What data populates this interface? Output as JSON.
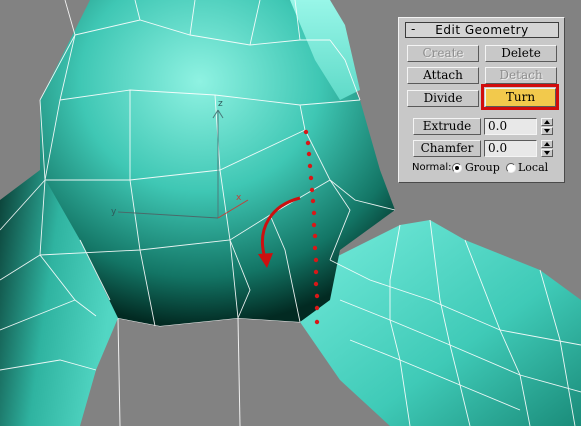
{
  "panel": {
    "collapse_symbol": "-",
    "title": "Edit Geometry",
    "buttons": {
      "create": "Create",
      "delete": "Delete",
      "attach": "Attach",
      "detach": "Detach",
      "divide": "Divide",
      "turn": "Turn",
      "extrude": "Extrude",
      "chamfer": "Chamfer"
    },
    "extrude_value": "0.0",
    "chamfer_value": "0.0",
    "normal_label": "Normal:",
    "normal_options": [
      "Group",
      "Local"
    ],
    "normal_selected": "Group"
  },
  "viewport": {
    "gizmo_axes": [
      "z",
      "x",
      "y"
    ],
    "colors": {
      "background": "#828282",
      "mesh": "#5fd9c6",
      "edges": "#ffffff",
      "annotation": "#d10c0c",
      "turn_button": "#f2c94c"
    },
    "icons": [
      "curved-arrow-icon",
      "edge-dotted-line"
    ]
  }
}
